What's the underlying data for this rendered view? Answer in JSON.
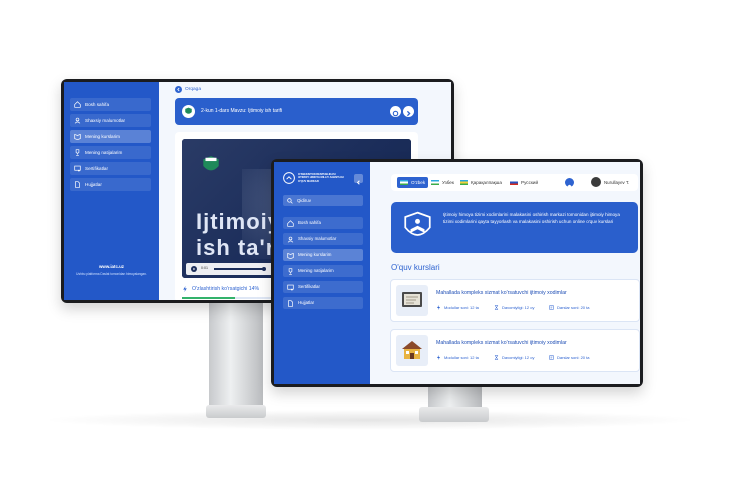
{
  "back_screen": {
    "sidebar": {
      "items": [
        {
          "label": "Bosh sahifa",
          "icon": "home-icon"
        },
        {
          "label": "Shaxsiy malumotlar",
          "icon": "user-icon"
        },
        {
          "label": "Mening kurslarim",
          "icon": "book-icon",
          "active": true
        },
        {
          "label": "Mening natijalarim",
          "icon": "trophy-icon"
        },
        {
          "label": "Sertifikatlar",
          "icon": "certificate-icon"
        },
        {
          "label": "Hujjatlar",
          "icon": "document-icon"
        }
      ],
      "site": "www.iatc.uz",
      "copyright": "Ushbu platforma Davlat tomonidan himoyalangan."
    },
    "back_link": "Orqaga",
    "lesson_header": "2-kun 1-dars Mavzu: Ijtimoiy ish tarifi",
    "video": {
      "overlay_line1": "Ijtimoiy",
      "overlay_line2": "ish ta'r",
      "time": "0:01"
    },
    "bottom_text": "O'zlashtirish ko'rsatgichi 14%"
  },
  "front_screen": {
    "org_name_lines": [
      "O'ZBEKISTON RESPUBLIKASI",
      "IJTIMOIY HIMOYA MILLIY AGENTLIGI",
      "O'QUV MARKAZI"
    ],
    "search_placeholder": "Qidiruv",
    "sidebar": {
      "items": [
        {
          "label": "Bosh sahifa",
          "icon": "home-icon"
        },
        {
          "label": "Shaxsiy malumotlar",
          "icon": "user-icon"
        },
        {
          "label": "Mening kurslarim",
          "icon": "book-icon",
          "active": true
        },
        {
          "label": "Mening natijalarim",
          "icon": "trophy-icon"
        },
        {
          "label": "Sertifikatlar",
          "icon": "certificate-icon"
        },
        {
          "label": "Hujjatlar",
          "icon": "document-icon"
        }
      ]
    },
    "languages": [
      {
        "label": "O'zbek",
        "active": true
      },
      {
        "label": "Узбек"
      },
      {
        "label": "Қарақалпақша"
      },
      {
        "label": "Русский"
      }
    ],
    "user_name": "Nurullayev T.",
    "banner_text": "Ijtimoiy himoya tizimi xodimlarini malakasini oshirish markazi tomonidan ijtimoiy himoya tizimi xodimlarini qayta tayyorlash va malakasini oshirish uchun online o'quv kurslari",
    "courses_title": "O'quv kurslari",
    "courses": [
      {
        "title": "Mahallada kompleks xizmat ko'rsatuvchi ijtimoiy xodimlar",
        "modules": "Modullar soni: 12 ta",
        "duration": "Davomiyligi: 12 oy",
        "lessons": "Darslar soni: 20 ta"
      },
      {
        "title": "Mahallada kompleks xizmat ko'rsatuvchi ijtimoiy xodimlar",
        "modules": "Modullar soni: 12 ta",
        "duration": "Davomiyligi: 12 oy",
        "lessons": "Darslar soni: 20 ta"
      }
    ]
  },
  "colors": {
    "sidebar_blue": "#2358c8",
    "accent_blue": "#2e63d0",
    "bezel": "#1b1c1f"
  }
}
